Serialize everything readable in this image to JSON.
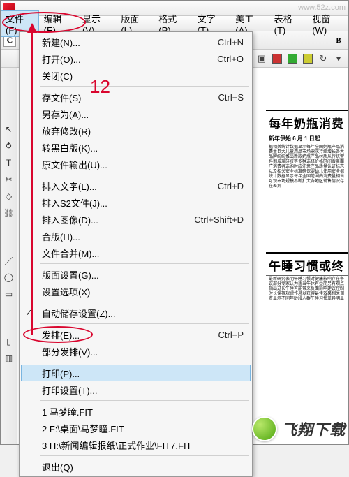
{
  "menubar": {
    "file": "文件(F)",
    "edit": "编辑(E)",
    "view": "显示(V)",
    "layout": "版面(L)",
    "format": "格式(P)",
    "text": "文字(T)",
    "art": "美工(A)",
    "table": "表格(T)",
    "window": "视窗(W)"
  },
  "file_menu": {
    "new": {
      "label": "新建(N)...",
      "shortcut": "Ctrl+N"
    },
    "open": {
      "label": "打开(O)...",
      "shortcut": "Ctrl+O"
    },
    "close": {
      "label": "关闭(C)",
      "shortcut": ""
    },
    "save": {
      "label": "存文件(S)",
      "shortcut": "Ctrl+S"
    },
    "saveas": {
      "label": "另存为(A)...",
      "shortcut": ""
    },
    "discard": {
      "label": "放弃修改(R)",
      "shortcut": ""
    },
    "whiteboard": {
      "label": "转黑白版(K)...",
      "shortcut": ""
    },
    "origexport": {
      "label": "原文件输出(U)...",
      "shortcut": ""
    },
    "inserttext": {
      "label": "排入文字(L)...",
      "shortcut": "Ctrl+D"
    },
    "inserts2": {
      "label": "排入S2文件(J)...",
      "shortcut": ""
    },
    "insertimage": {
      "label": "排入图像(D)...",
      "shortcut": "Ctrl+Shift+D"
    },
    "combine": {
      "label": "合版(H)...",
      "shortcut": ""
    },
    "filemerge": {
      "label": "文件合并(M)...",
      "shortcut": ""
    },
    "pagesetup": {
      "label": "版面设置(G)...",
      "shortcut": ""
    },
    "options": {
      "label": "设置选项(X)",
      "shortcut": ""
    },
    "autosave": {
      "label": "自动储存设置(Z)...",
      "shortcut": ""
    },
    "publish": {
      "label": "发排(E)...",
      "shortcut": "Ctrl+P"
    },
    "partial": {
      "label": "部分发排(V)...",
      "shortcut": ""
    },
    "print": {
      "label": "打印(P)...",
      "shortcut": ""
    },
    "printsetup": {
      "label": "打印设置(T)...",
      "shortcut": ""
    },
    "recent1": {
      "label": "1 马梦瞳.FIT"
    },
    "recent2": {
      "label": "2 F:\\桌面\\马梦瞳.FIT"
    },
    "recent3": {
      "label": "3 H:\\新闻编辑报纸\\正式作业\\FIT7.FIT"
    },
    "exit": {
      "label": "退出(Q)"
    }
  },
  "toolbar": {
    "c_label": "C",
    "b_label": "B"
  },
  "annotation": {
    "step": "12"
  },
  "document": {
    "headline1": "每年奶瓶消费",
    "subhead1": "新年伊始 6 月 1 日起",
    "headline2": "午睡习惯或终"
  },
  "watermark": "www.52z.com",
  "footer": {
    "brand": "飞翔下载"
  }
}
